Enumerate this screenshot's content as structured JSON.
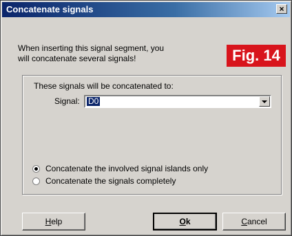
{
  "window": {
    "title": "Concatenate signals",
    "close_label": "×"
  },
  "intro": {
    "line1": "When inserting this signal segment, you",
    "line2": "will concatenate several signals!"
  },
  "figure_badge": "Fig. 14",
  "group": {
    "label": "These signals will be concatenated to:",
    "signal_label": "Signal:",
    "signal_value": "D0"
  },
  "options": {
    "selected_index": 0,
    "items": [
      "Concatenate the involved signal islands only",
      "Concatenate the signals completely"
    ]
  },
  "buttons": {
    "help": {
      "first": "H",
      "rest": "elp"
    },
    "ok": {
      "first": "O",
      "rest": "k"
    },
    "cancel": {
      "first": "C",
      "rest": "ancel"
    }
  },
  "colors": {
    "titlebar": "#0a246a",
    "badge": "#d8141c",
    "face": "#d6d3ce"
  }
}
